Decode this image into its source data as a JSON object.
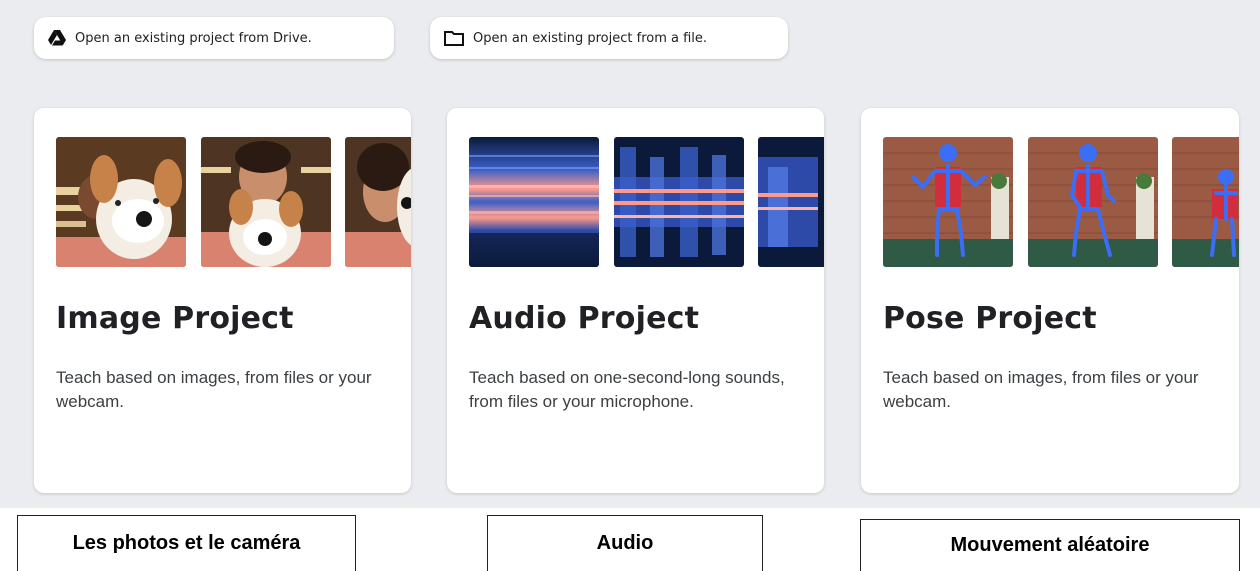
{
  "open_buttons": {
    "drive": {
      "label": "Open an existing project from Drive.",
      "icon": "google-drive-icon"
    },
    "file": {
      "label": "Open an existing project from a file.",
      "icon": "folder-icon"
    }
  },
  "cards": {
    "image": {
      "title": "Image Project",
      "description": "Teach based on images, from files or your webcam."
    },
    "audio": {
      "title": "Audio Project",
      "description": "Teach based on one-second-long sounds, from files or your microphone."
    },
    "pose": {
      "title": "Pose Project",
      "description": "Teach based on images, from files or your webcam."
    }
  },
  "captions": {
    "image": "Les photos et le caméra",
    "audio": "Audio",
    "pose": "Mouvement aléatoire"
  },
  "colors": {
    "background": "#eaecef",
    "card": "#ffffff",
    "text_primary": "#202124",
    "text_secondary": "#3c4043",
    "spectrogram_dark": "#0b1a3a",
    "spectrogram_hot": "#ff9a8a",
    "skeleton": "#3b6ef5"
  }
}
